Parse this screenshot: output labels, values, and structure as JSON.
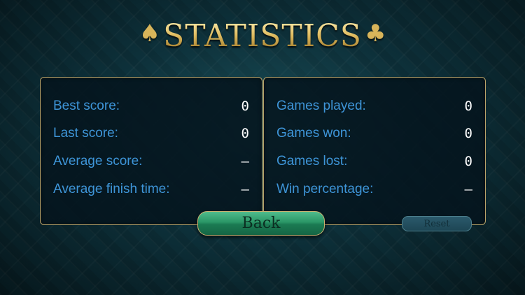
{
  "header": {
    "title": "STATISTICS",
    "left_suit_icon": "spade-icon",
    "right_suit_icon": "club-icon"
  },
  "score_panel": {
    "rows": [
      {
        "label": "Best score:",
        "value": "0"
      },
      {
        "label": "Last score:",
        "value": "0"
      },
      {
        "label": "Average score:",
        "value": "–"
      },
      {
        "label": "Average finish time:",
        "value": "–"
      }
    ]
  },
  "games_panel": {
    "rows": [
      {
        "label": "Games played:",
        "value": "0"
      },
      {
        "label": "Games won:",
        "value": "0"
      },
      {
        "label": "Games lost:",
        "value": "0"
      },
      {
        "label": "Win percentage:",
        "value": "–"
      }
    ]
  },
  "buttons": {
    "back_label": "Back",
    "reset_label": "Reset"
  },
  "colors": {
    "label_blue": "#3e95d8",
    "value_white": "#ffffff",
    "gold": "#d9b65c",
    "back_green": "#2a9666"
  }
}
